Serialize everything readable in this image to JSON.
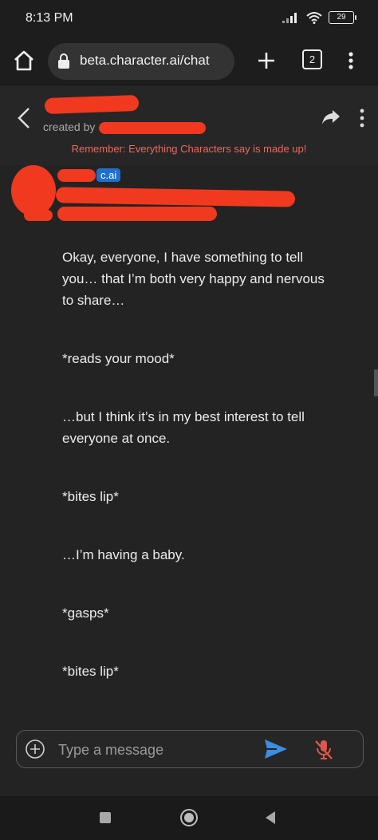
{
  "status_bar": {
    "time": "8:13 PM",
    "battery": "29"
  },
  "browser": {
    "url": "beta.character.ai/chat",
    "tab_count": "2"
  },
  "chat_header": {
    "created_by": "created by",
    "disclaimer": "Remember: Everything Characters say is made up!"
  },
  "message": {
    "badge": "c.ai",
    "lines": [
      "Okay, everyone, I have something to tell you… that I’m both very happy and nervous to share…",
      "*reads your mood*",
      "…but I think it’s in my best interest to tell everyone at once.",
      "*bites lip*",
      "…I’m having a baby.",
      "*gasps*",
      "*bites lip*"
    ]
  },
  "input": {
    "placeholder": "Type a message"
  },
  "colors": {
    "accent": "#3d8de0",
    "badge": "#1f6fcb",
    "disclaimer": "#e86a62",
    "redaction": "#f0391e",
    "mic_off": "#e0564d"
  },
  "icons": [
    "home-icon",
    "lock-icon",
    "plus-icon",
    "tabs-icon",
    "more-vert-icon",
    "back-arrow-icon",
    "share-icon",
    "add-circle-icon",
    "send-icon",
    "mic-off-icon",
    "nav-recents-icon",
    "nav-home-icon",
    "nav-back-icon"
  ]
}
